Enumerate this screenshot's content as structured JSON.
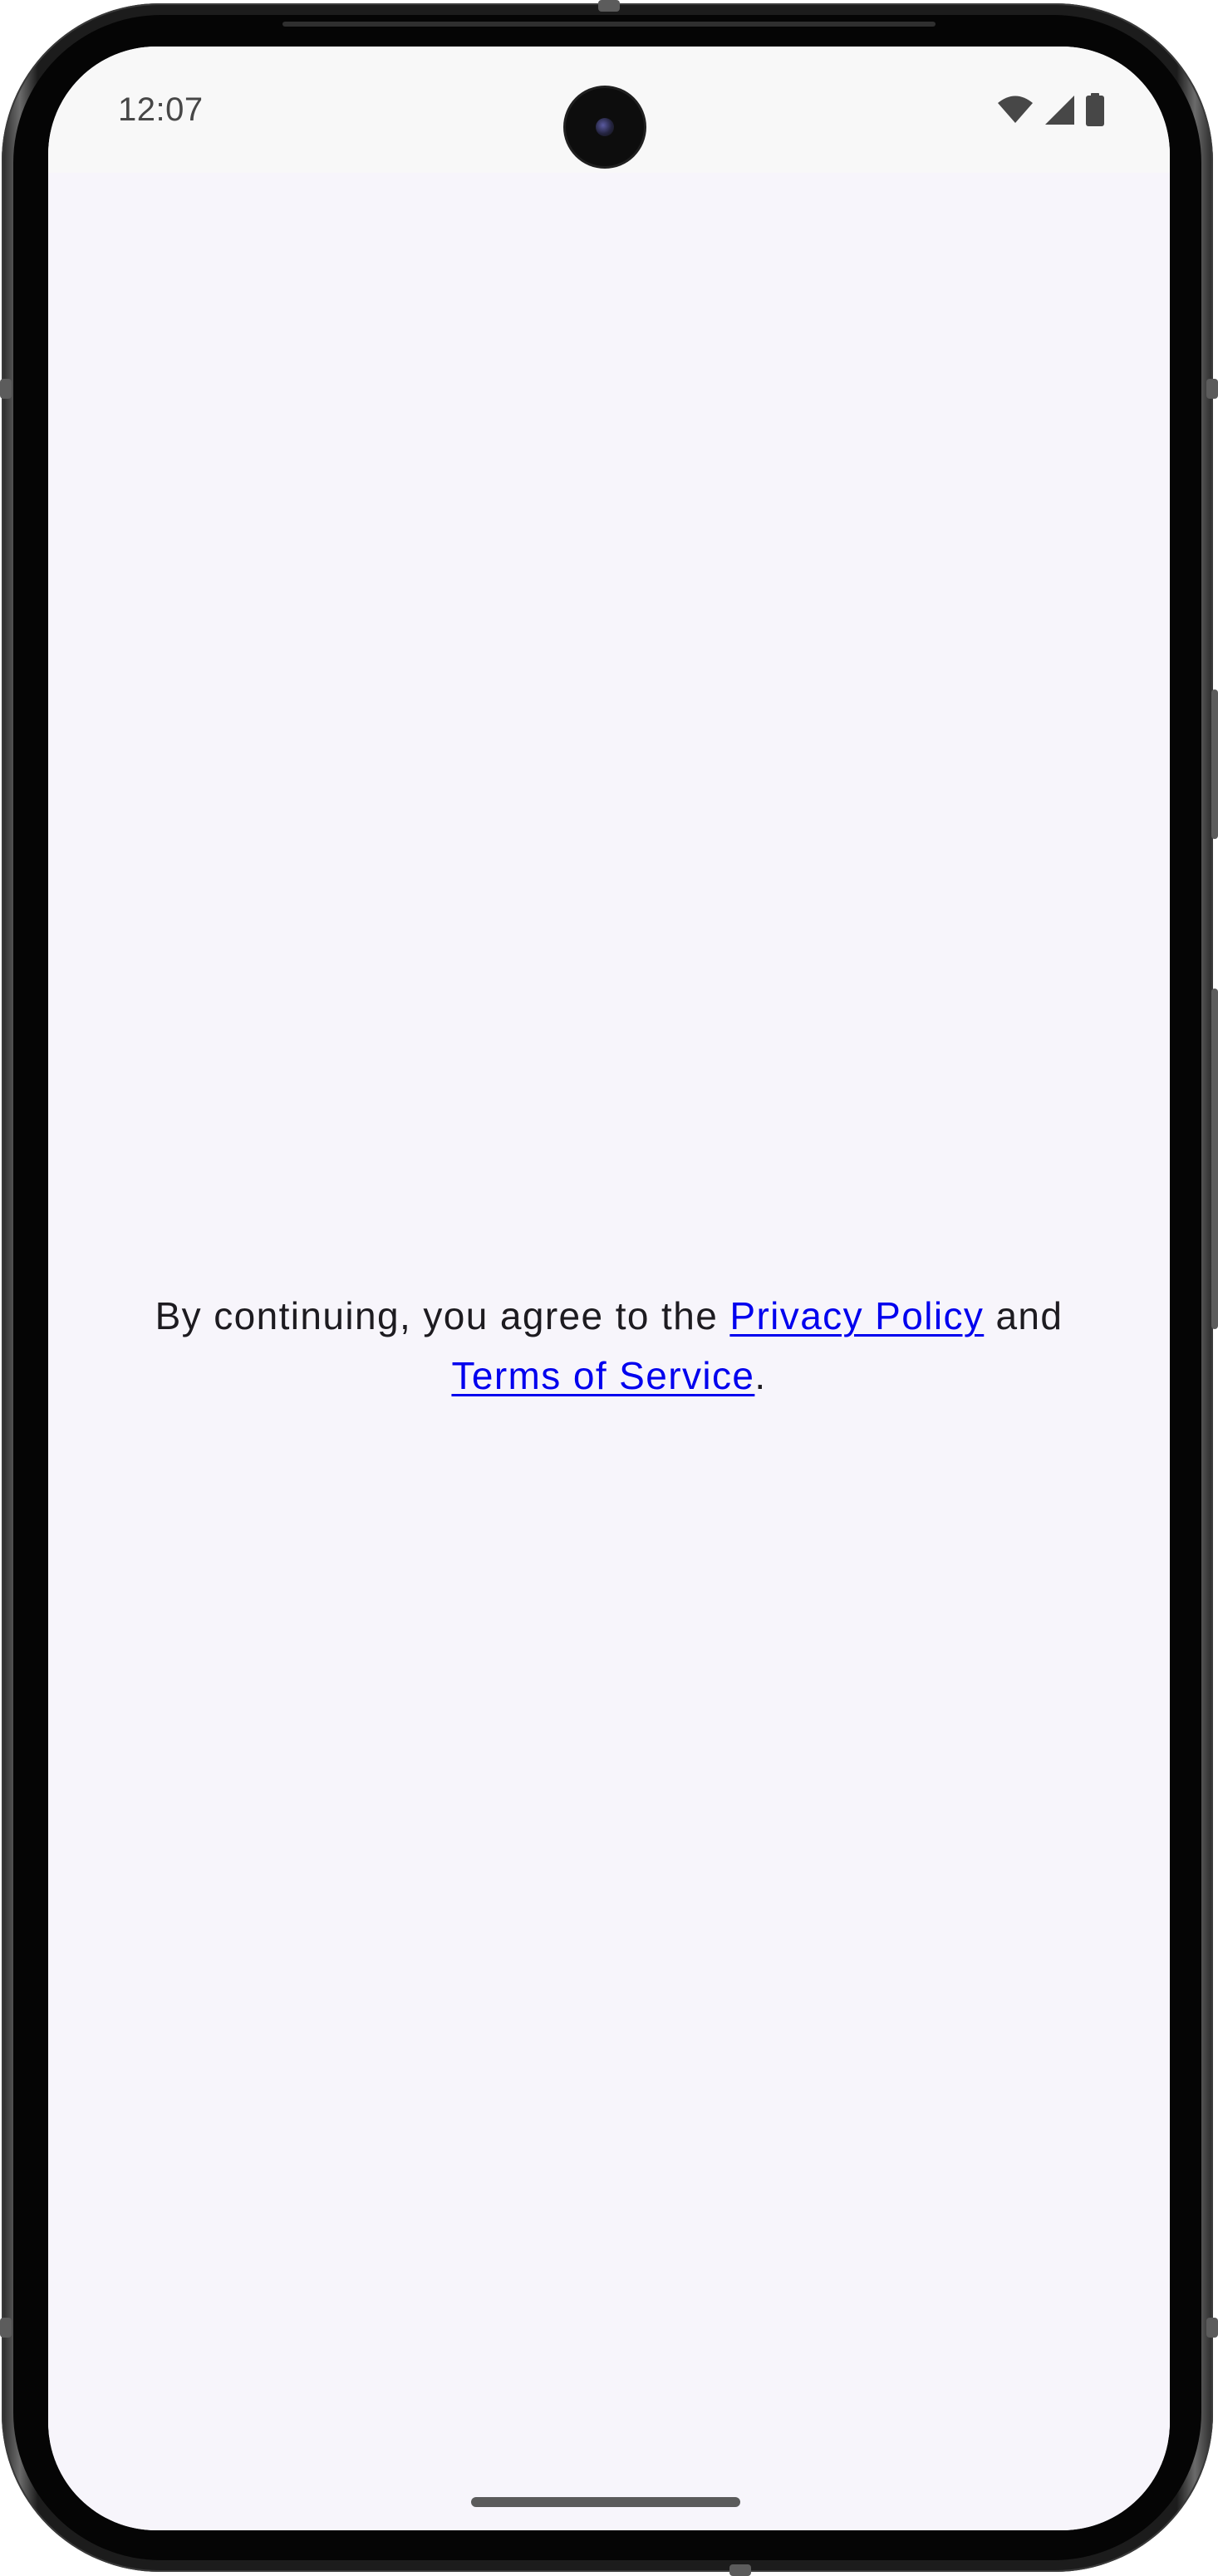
{
  "status_bar": {
    "time": "12:07",
    "icons": [
      "wifi-icon",
      "cellular-signal-icon",
      "battery-icon"
    ]
  },
  "consent": {
    "prefix": "By continuing, you agree to the ",
    "privacy_link": "Privacy Policy",
    "middle": " and ",
    "terms_link": "Terms of Service",
    "suffix": "."
  },
  "colors": {
    "screen_background": "#f7f5fb",
    "status_bar_background": "#f8f8f8",
    "text": "#1d1b20",
    "link": "#0000ee",
    "status_icon": "#474747"
  }
}
